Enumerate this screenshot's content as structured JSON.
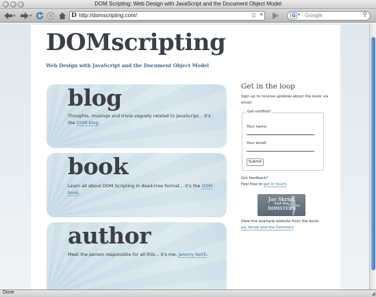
{
  "window": {
    "title": "DOM Scripting: Web Design with JavaScript and the Document Object Model"
  },
  "toolbar": {
    "back_icon": "back-arrow-icon",
    "forward_icon": "forward-arrow-icon",
    "reload_icon": "reload-icon",
    "stop_icon": "stop-icon",
    "home_icon": "home-icon",
    "url": "http://domscripting.com/",
    "favicon_letter": "D",
    "search_placeholder": "Google",
    "search_engine_letter": "G"
  },
  "page": {
    "site_title": "DOMscripting",
    "tagline": "Web Design with JavaScript and the Document Object Model",
    "cards": [
      {
        "title": "blog",
        "text_before": "Thoughts, musings and trivia vaguely related to JavaScript... it's the ",
        "link": "DOM blog",
        "text_after": "."
      },
      {
        "title": "book",
        "text_before": "Learn all about DOM Scripting in dead-tree format... it's the ",
        "link": "DOM book",
        "text_after": "."
      },
      {
        "title": "author",
        "text_before": "Meet the person responsible for all this... it's me, ",
        "link": "Jeremy Keith",
        "text_after": "."
      }
    ],
    "sidebar": {
      "heading": "Get in the loop",
      "intro": "Sign up to receive updates about the book via email.",
      "form": {
        "legend": "Get notified!",
        "name_label": "Your name",
        "email_label": "Your email",
        "submit": "Submit"
      },
      "feedback_line1": "Got feedback?",
      "feedback_before": "Feel free to ",
      "feedback_link": "get in touch",
      "feedback_after": ".",
      "band_logo_lines": [
        "Jay Skript",
        "and the",
        "DOMSTERS"
      ],
      "example_text": "View the example website from the book:",
      "example_link": "Jay Skript and the Domsters"
    }
  },
  "status": {
    "text": "Done"
  },
  "colors": {
    "accent": "#3f6c88",
    "heading": "#3b3f47",
    "card_bg": "#d5e5ee",
    "page_bg": "#dfe8ef"
  }
}
